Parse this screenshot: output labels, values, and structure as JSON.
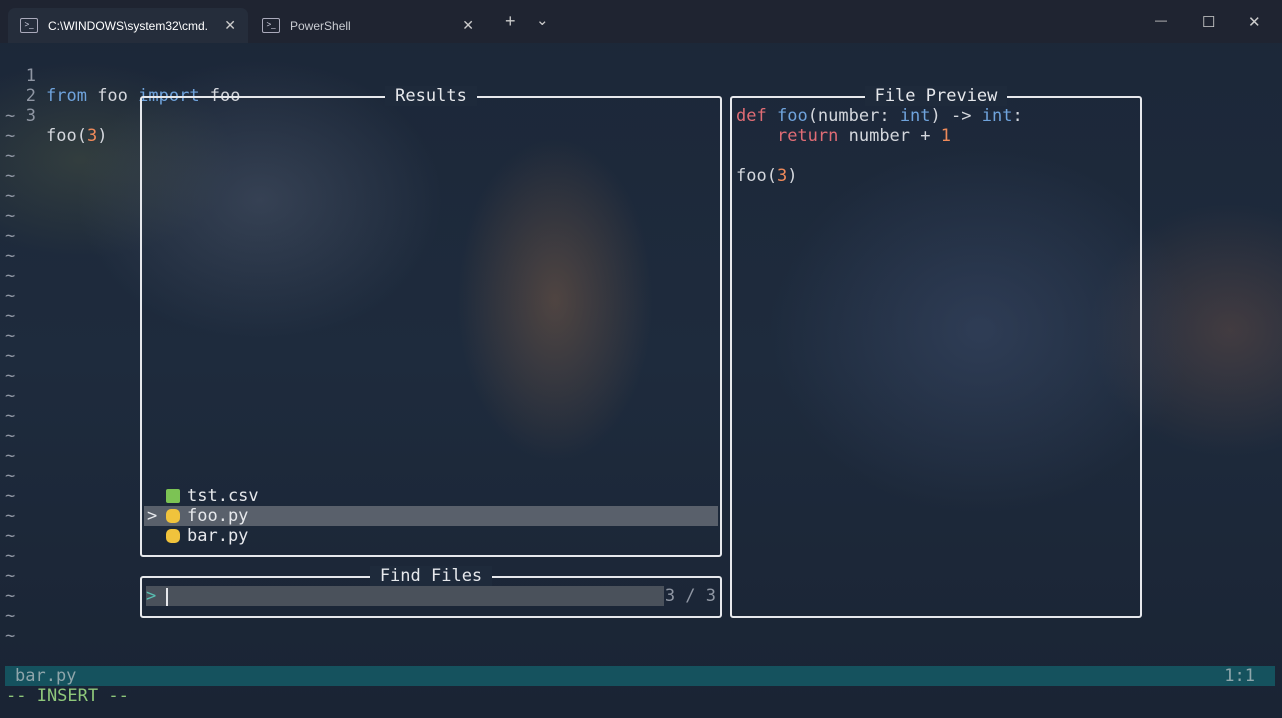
{
  "window": {
    "tabs": [
      {
        "label": "C:\\WINDOWS\\system32\\cmd.",
        "active": true
      },
      {
        "label": "PowerShell",
        "active": false
      }
    ],
    "new_tab": "+",
    "dropdown": "⌄",
    "minimize": "—",
    "maximize": "☐",
    "close": "✕",
    "tab_close": "✕",
    "tab_icon": ">_"
  },
  "editor": {
    "lines": [
      {
        "num": "1",
        "tokens": [
          "from",
          " foo ",
          "import",
          " foo"
        ]
      },
      {
        "num": "2"
      },
      {
        "num": "3",
        "pre": "foo(",
        "arg": "3",
        "post": ")"
      }
    ],
    "tilde": "~"
  },
  "results": {
    "title": "Results",
    "items": [
      {
        "name": "tst.csv",
        "icon": "csv-file-icon"
      },
      {
        "name": "foo.py",
        "icon": "python-file-icon",
        "selected": true
      },
      {
        "name": "bar.py",
        "icon": "python-file-icon"
      }
    ],
    "selection_marker": ">"
  },
  "preview": {
    "title": "File Preview",
    "line1": {
      "def": "def",
      "fn": "foo",
      "a": "(number: ",
      "t1": "int",
      "b": ") -> ",
      "t2": "int",
      "c": ":"
    },
    "line2": {
      "indent": "    ",
      "ret": "return",
      "mid": " number + ",
      "one": "1"
    },
    "line4": {
      "pre": "foo(",
      "arg": "3",
      "post": ")"
    }
  },
  "find": {
    "title": "Find Files",
    "prompt": ">",
    "input_value": "",
    "counter": "3 / 3"
  },
  "status": {
    "filename": "bar.py",
    "position": "1:1",
    "mode": "-- INSERT --"
  }
}
